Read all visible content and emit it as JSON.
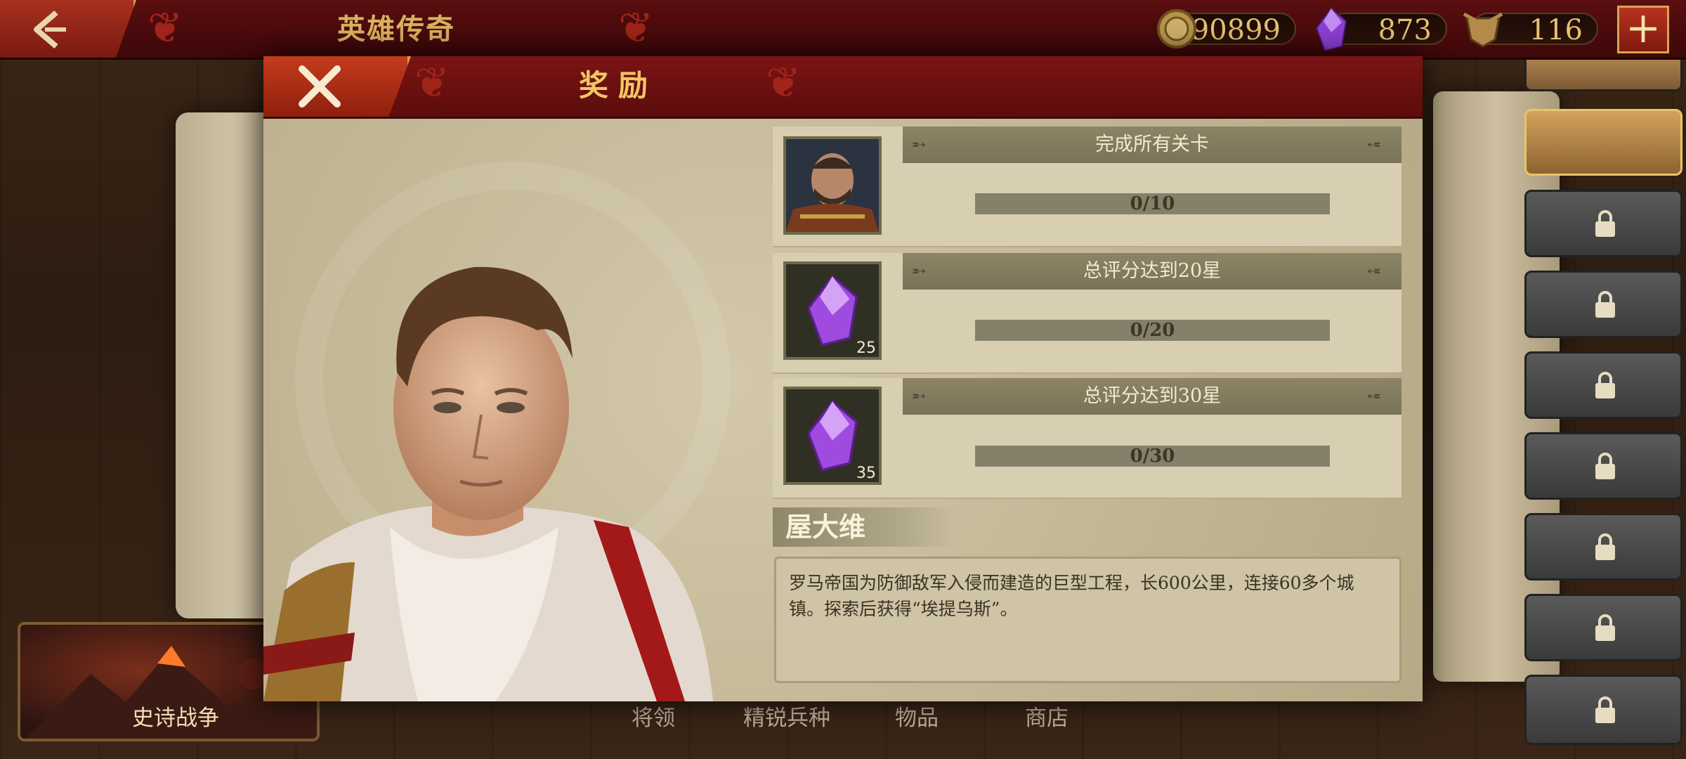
{
  "top_bar": {
    "title": "英雄传奇",
    "coins": "90899",
    "gems": "873",
    "honor": "116"
  },
  "modal": {
    "title": "奖励",
    "rewards": [
      {
        "label": "完成所有关卡",
        "progress": "0/10",
        "reward_type": "hero-portrait",
        "count": ""
      },
      {
        "label": "总评分达到20星",
        "progress": "0/20",
        "reward_type": "gem",
        "count": "25"
      },
      {
        "label": "总评分达到30星",
        "progress": "0/30",
        "reward_type": "gem",
        "count": "35"
      }
    ],
    "hero_name": "屋大维",
    "description": "罗马帝国为防御敌军入侵而建造的巨型工程，长600公里，连接60多个城镇。探索后获得“埃提乌斯”。"
  },
  "bottom": {
    "epic_war": "史诗战争",
    "tabs": [
      "将领",
      "精锐兵种",
      "物品",
      "商店"
    ]
  },
  "colors": {
    "header_red": "#6b1111",
    "gold": "#f0c764",
    "parchment": "#c2b695",
    "gem_purple": "#a04be0"
  }
}
